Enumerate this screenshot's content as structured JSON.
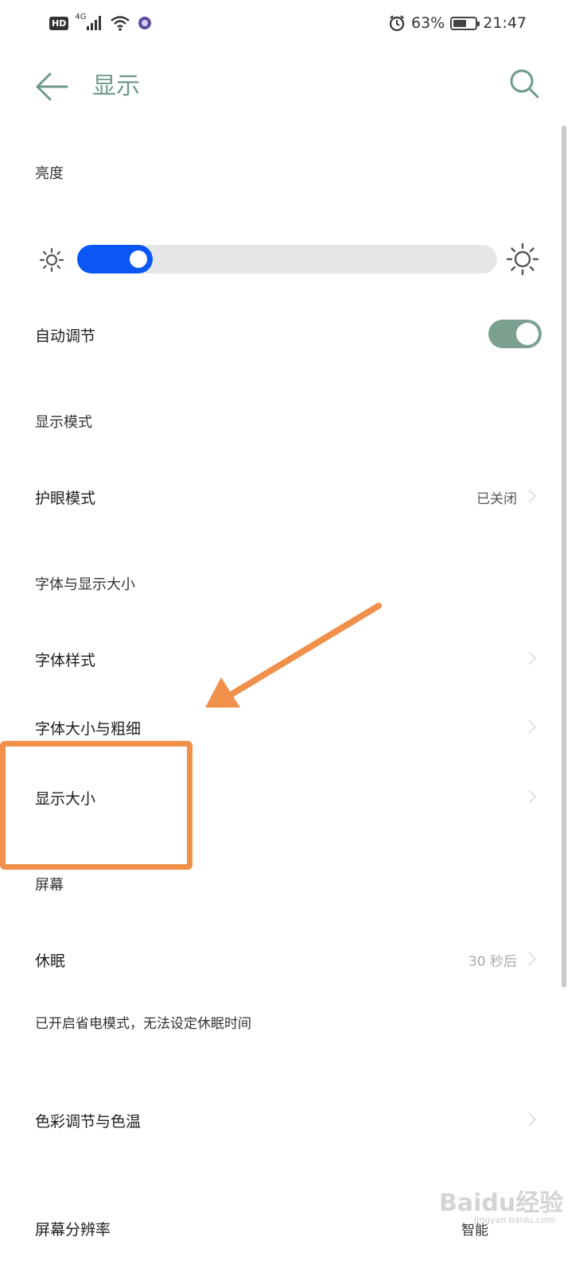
{
  "status_bar": {
    "hd": "HD",
    "network": "4G",
    "battery_percent": "63%",
    "battery_level": 0.63,
    "time": "21:47",
    "icons": [
      "hd-icon",
      "signal-icon",
      "wifi-icon",
      "app-notification-icon",
      "alarm-icon",
      "battery-icon"
    ]
  },
  "header": {
    "title": "显示",
    "back_icon": "back-arrow-icon",
    "search_icon": "search-icon"
  },
  "brightness": {
    "section": "亮度",
    "level": 0.18,
    "auto_label": "自动调节",
    "auto_on": true
  },
  "display_mode": {
    "section": "显示模式",
    "eye_comfort": {
      "label": "护眼模式",
      "value": "已关闭"
    }
  },
  "font_display": {
    "section": "字体与显示大小",
    "items": [
      {
        "label": "字体样式"
      },
      {
        "label": "字体大小与粗细"
      },
      {
        "label": "显示大小"
      }
    ]
  },
  "screen": {
    "section": "屏幕",
    "sleep": {
      "label": "休眠",
      "value": "30 秒后"
    },
    "hint": "已开启省电模式，无法设定休眠时间",
    "color": {
      "label": "色彩调节与色温"
    },
    "resolution": {
      "label": "屏幕分辨率",
      "value": "智能"
    }
  },
  "colors": {
    "accent": "#6d9a8b",
    "slider_fill": "#0a57f5",
    "toggle_on": "#7ca08f",
    "annotation": "#f0904a"
  },
  "watermark": {
    "text": "Baidu经验",
    "sub": "jingyan.baidu.com"
  }
}
